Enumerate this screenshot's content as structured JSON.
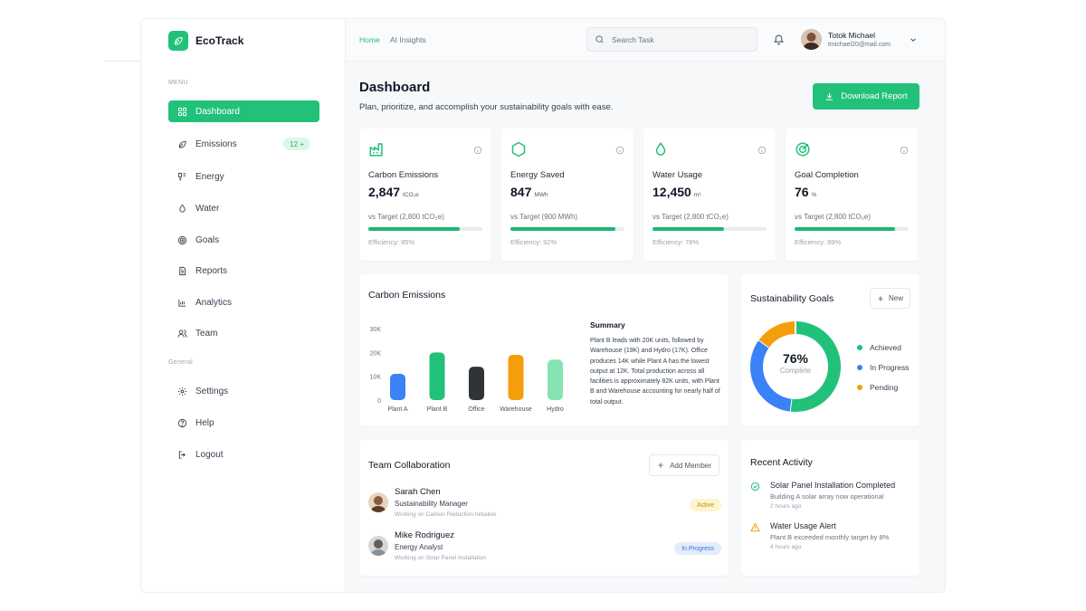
{
  "brand": {
    "name": "EcoTrack"
  },
  "sidebar": {
    "menu_label": "MENU",
    "general_label": "General",
    "items": [
      {
        "label": "Dashboard",
        "icon": "dashboard-icon"
      },
      {
        "label": "Emissions",
        "icon": "leaf-icon",
        "badge": "12 +"
      },
      {
        "label": "Energy",
        "icon": "energy-icon"
      },
      {
        "label": "Water",
        "icon": "water-drop-icon"
      },
      {
        "label": "Goals",
        "icon": "goals-icon"
      },
      {
        "label": "Reports",
        "icon": "report-icon"
      },
      {
        "label": "Analytics",
        "icon": "analytics-icon"
      },
      {
        "label": "Team",
        "icon": "team-icon"
      }
    ],
    "general_items": [
      {
        "label": "Settings",
        "icon": "gear-icon"
      },
      {
        "label": "Help",
        "icon": "help-icon"
      },
      {
        "label": "Logout",
        "icon": "logout-icon"
      }
    ]
  },
  "header": {
    "nav": [
      {
        "label": "Home"
      },
      {
        "label": "AI Insights"
      }
    ],
    "search_placeholder": "Search Task",
    "user": {
      "name": "Totok Michael",
      "email": "tmichael20@mail.com"
    }
  },
  "page": {
    "title": "Dashboard",
    "subtitle": "Plan, prioritize, and accomplish your sustainability goals with ease.",
    "download_label": "Download Report"
  },
  "stats": [
    {
      "label": "Carbon Emissions",
      "value": "2,847",
      "unit": "tCO₂e",
      "target": "vs Target (2,800 tCO₂e)",
      "progress": 0.8,
      "efficiency": "Efficiency: 85%",
      "icon": "factory-icon"
    },
    {
      "label": "Energy Saved",
      "value": "847",
      "unit": "MWh",
      "target": "vs Target (900 MWh)",
      "progress": 0.92,
      "efficiency": "Efficiency: 92%",
      "icon": "hexagon-icon"
    },
    {
      "label": "Water Usage",
      "value": "12,450",
      "unit": "m³",
      "target": "vs Target (2,800 tCO₂e)",
      "progress": 0.63,
      "efficiency": "Efficiency: 78%",
      "icon": "water-drop-icon"
    },
    {
      "label": "Goal Completion",
      "value": "76",
      "unit": "%",
      "target": "vs Target (2,800 tCO₂e)",
      "progress": 0.88,
      "efficiency": "Efficiency: 89%",
      "icon": "target-icon"
    }
  ],
  "chart_data": [
    {
      "type": "bar",
      "title": "Carbon Emissions",
      "categories": [
        "Plant A",
        "Plant B",
        "Office",
        "Warehouse",
        "Hydro"
      ],
      "values": [
        11000,
        20000,
        14000,
        19000,
        17000
      ],
      "colors": [
        "#3b82f6",
        "#22c17a",
        "#2f3437",
        "#f59e0b",
        "#86e3b3"
      ],
      "y_ticks": [
        "0",
        "10K",
        "20K",
        "30K"
      ],
      "ylim": [
        0,
        30000
      ],
      "grid": false,
      "summary_title": "Summary",
      "summary_text": "Plant B leads with 20K units, followed by Warehouse (19K) and Hydro (17K). Office produces 14K while Plant A has the lowest output at 12K. Total production across all facilities is approximately 82K units, with Plant B and Warehouse accounting for nearly half of total output."
    },
    {
      "type": "pie",
      "title": "Sustainability Goals",
      "labels": [
        "Achieved",
        "In Progress",
        "Pending"
      ],
      "values": [
        52,
        33,
        15
      ],
      "colors": [
        "#22c17a",
        "#3b82f6",
        "#f59e0b"
      ],
      "center_value": "76%",
      "center_label": "Complete",
      "legend": "right"
    }
  ],
  "goals": {
    "new_label": "New"
  },
  "team": {
    "title": "Team Collaboration",
    "add_label": "Add Member",
    "members": [
      {
        "name": "Sarah Chen",
        "role": "Sustainability Manager",
        "work": "Working on Carbon Reduction Initiative",
        "status": "Active"
      },
      {
        "name": "Mike Rodriguez",
        "role": "Energy Analyst",
        "work": "Working on Solar Panel Installation",
        "status": "In Progress"
      }
    ]
  },
  "activity": {
    "title": "Recent Activity",
    "items": [
      {
        "title": "Solar Panel Installation Completed",
        "desc": "Building A solar array now operational",
        "time": "2 hours ago",
        "icon": "check-circle-icon"
      },
      {
        "title": "Water Usage Alert",
        "desc": "Plant B exceeded monthly target by 8%",
        "time": "4 hours ago",
        "icon": "warning-icon"
      }
    ]
  },
  "colors": {
    "accent": "#22c17a",
    "blue": "#3b82f6",
    "amber": "#f59e0b"
  }
}
